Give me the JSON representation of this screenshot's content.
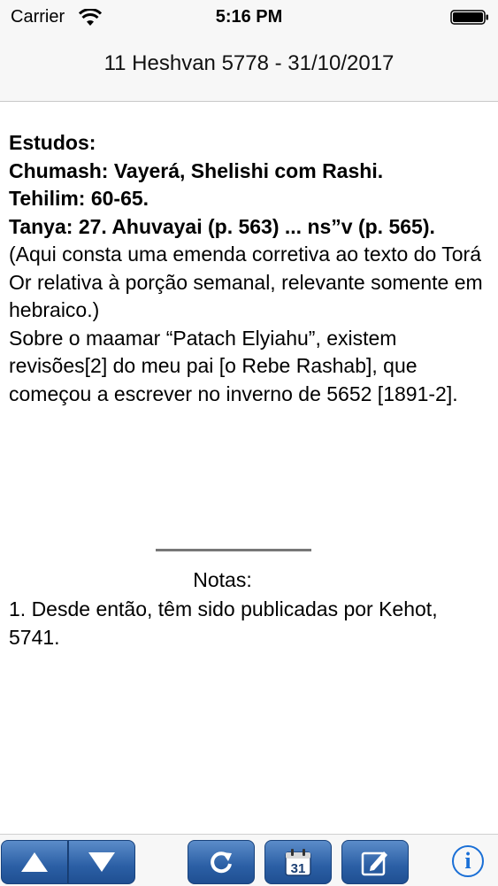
{
  "status_bar": {
    "carrier": "Carrier",
    "time": "5:16 PM"
  },
  "nav": {
    "title": "11 Heshvan 5778 - 31/10/2017"
  },
  "content": {
    "heading": "Estudos:",
    "chumash": "Chumash: Vayerá, Shelishi com Rashi.",
    "tehilim": "Tehilim: 60-65.",
    "tanya": "Tanya: 27. Ahuvayai (p. 563) ... ns”v (p. 565).",
    "paragraph1": "(Aqui consta uma emenda corretiva ao texto do Torá Or relativa à porção semanal, relevante somente em hebraico.)",
    "paragraph2": "Sobre o maamar “Patach Elyiahu”, existem revisões[2] do meu pai [o Rebe Rashab], que começou a escrever no inverno de 5652 [1891-2]."
  },
  "notes": {
    "title": "Notas:",
    "items": [
      "1. Desde então, têm sido publicadas por Kehot, 5741."
    ]
  },
  "toolbar": {
    "calendar_day": "31",
    "info_label": "i"
  },
  "colors": {
    "toolbar_button": "#2b5fa5",
    "info_accent": "#1a6fd6"
  }
}
